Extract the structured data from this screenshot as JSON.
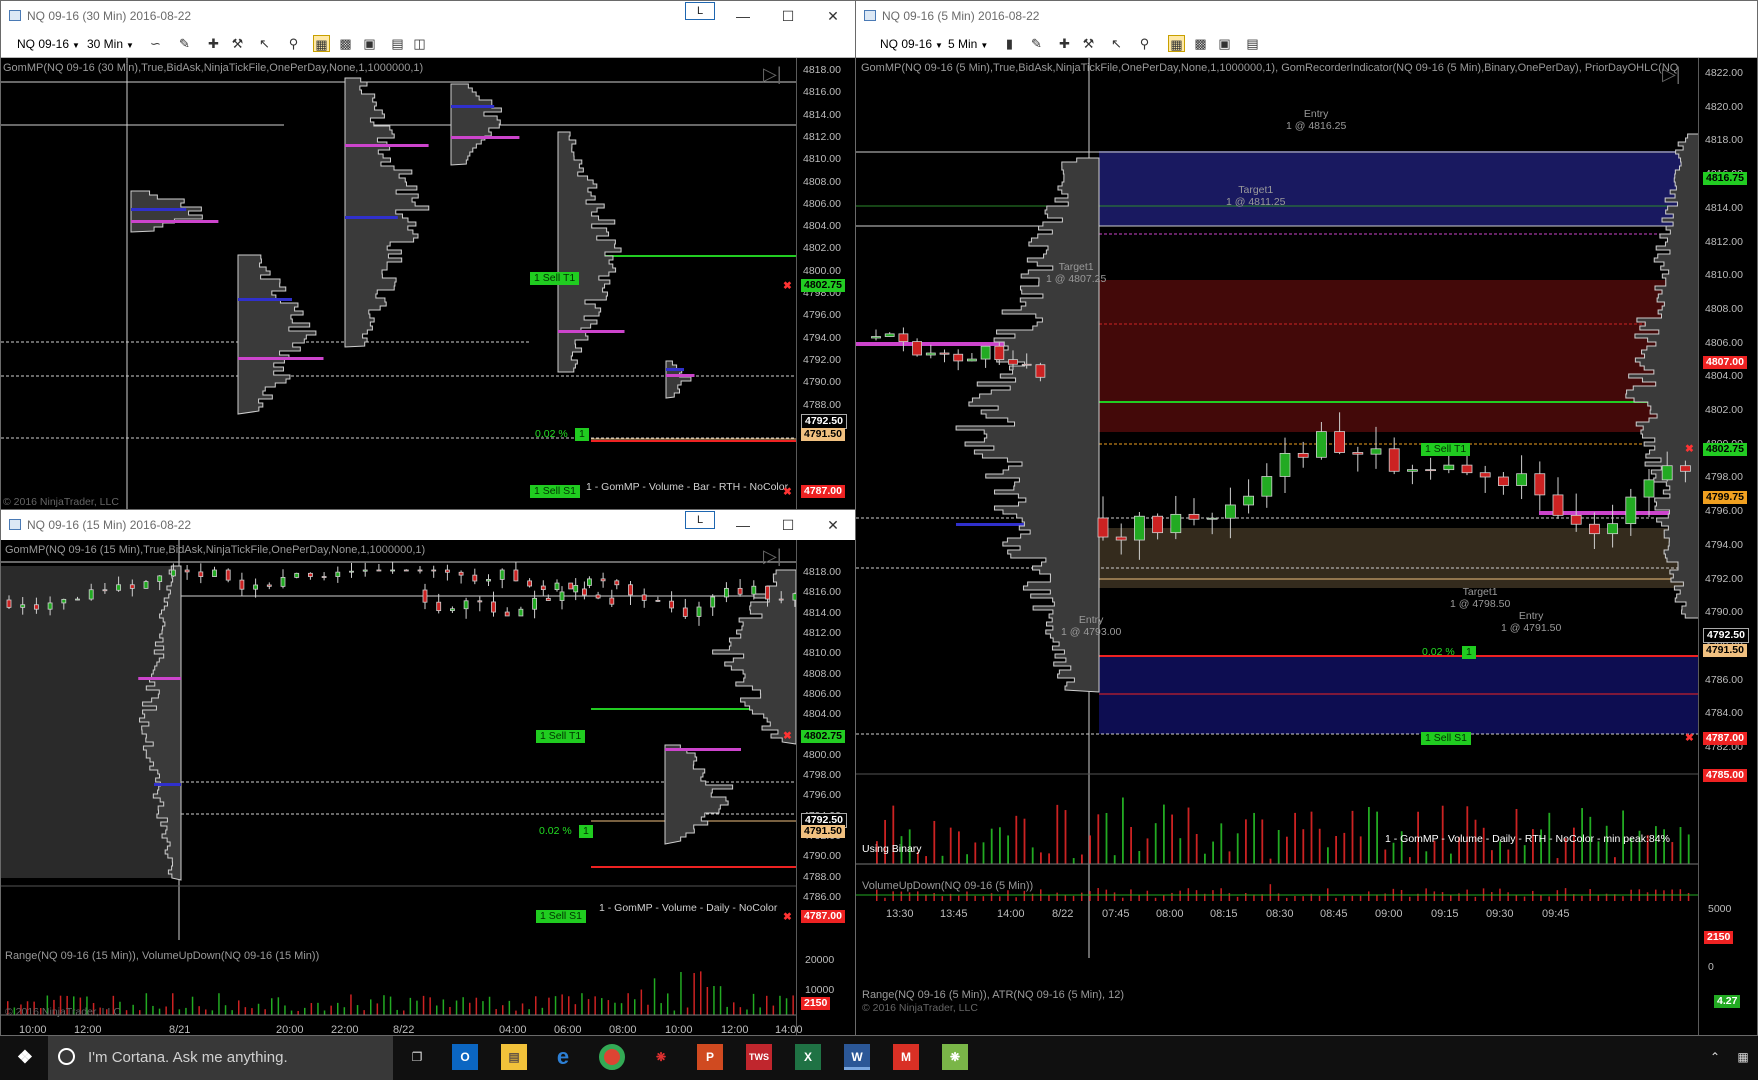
{
  "windows": [
    {
      "id": "w30",
      "title": "NQ 09-16 (30 Min)  2016-08-22",
      "instrument": "NQ 09-16",
      "interval": "30 Min",
      "link": "L",
      "indicator_label": "GomMP(NQ 09-16 (30 Min),True,BidAsk,NinjaTickFile,OnePerDay,None,1,1000000,1)",
      "ticks": [
        "4818.00",
        "4816.00",
        "4814.00",
        "4812.00",
        "4810.00",
        "4808.00",
        "4806.00",
        "4804.00",
        "4802.00",
        "4800.00",
        "4798.00",
        "4796.00",
        "4794.00",
        "4792.00",
        "4790.00",
        "4788.00"
      ],
      "price_tags": [
        {
          "text": "4802.75",
          "color": "#22cc22"
        },
        {
          "text": "4792.50",
          "color": "#ffffff"
        },
        {
          "text": "4791.50",
          "color": "#f0c080"
        },
        {
          "text": "4787.00",
          "color": "#ee2222"
        }
      ],
      "orders": [
        {
          "text": "1  Sell T1"
        },
        {
          "text": "1  Sell S1"
        }
      ],
      "pct": "0.02 %",
      "pct_qty": "1",
      "note": "1 - GomMP - Volume - Bar - RTH - NoColor",
      "copyright": "© 2016 NinjaTrader, LLC"
    },
    {
      "id": "w15",
      "title": "NQ 09-16 (15 Min)  2016-08-22",
      "instrument": "NQ 09-16",
      "interval": "15 Min",
      "link": "L",
      "indicator_label": "GomMP(NQ 09-16 (15 Min),True,BidAsk,NinjaTickFile,OnePerDay,None,1,1000000,1)",
      "ticks": [
        "4818.00",
        "4816.00",
        "4814.00",
        "4812.00",
        "4810.00",
        "4808.00",
        "4806.00",
        "4804.00",
        "4802.00",
        "4800.00",
        "4798.00",
        "4796.00",
        "4794.00",
        "4792.00",
        "4790.00",
        "4788.00",
        "4786.00"
      ],
      "price_tags": [
        {
          "text": "4802.75",
          "color": "#22cc22"
        },
        {
          "text": "4792.50",
          "color": "#ffffff"
        },
        {
          "text": "4791.50",
          "color": "#f0c080"
        },
        {
          "text": "4787.00",
          "color": "#ee2222"
        }
      ],
      "orders": [
        {
          "text": "1  Sell T1"
        },
        {
          "text": "1  Sell S1"
        }
      ],
      "pct": "0.02 %",
      "pct_qty": "1",
      "note": "1 - GomMP - Volume - Daily - NoColor",
      "sub_label": "Range(NQ 09-16 (15 Min)), VolumeUpDown(NQ 09-16 (15 Min))",
      "sub_ticks": [
        "20000",
        "10000"
      ],
      "sub_tag": "2150",
      "xticks": [
        "10:00",
        "12:00",
        "8/21",
        "20:00",
        "22:00",
        "8/22",
        "04:00",
        "06:00",
        "08:00",
        "10:00",
        "12:00",
        "14:00"
      ],
      "copyright": "© 2016 NinjaTrader, LLC"
    },
    {
      "id": "w5",
      "title": "NQ 09-16 (5 Min)  2016-08-22",
      "instrument": "NQ 09-16",
      "interval": "5 Min",
      "indicator_label": "GomMP(NQ 09-16 (5 Min),True,BidAsk,NinjaTickFile,OnePerDay,None,1,1000000,1), GomRecorderIndicator(NQ 09-16 (5 Min),Binary,OnePerDay), PriorDayOHLC(NQ",
      "ticks": [
        "4822.00",
        "4820.00",
        "4818.00",
        "4816.00",
        "4814.00",
        "4812.00",
        "4810.00",
        "4808.00",
        "4806.00",
        "4804.00",
        "4802.00",
        "4800.00",
        "4798.00",
        "4796.00",
        "4794.00",
        "4792.00",
        "4790.00",
        "4788.00",
        "4786.00",
        "4784.00",
        "4782.00"
      ],
      "price_tags": [
        {
          "text": "4816.75",
          "color": "#22cc22"
        },
        {
          "text": "4807.00",
          "color": "#ee2222"
        },
        {
          "text": "4802.75",
          "color": "#22cc22"
        },
        {
          "text": "4799.75",
          "color": "#f0a020"
        },
        {
          "text": "4792.50",
          "color": "#ffffff"
        },
        {
          "text": "4791.50",
          "color": "#f0c080"
        },
        {
          "text": "4787.00",
          "color": "#ee2222"
        },
        {
          "text": "4785.00",
          "color": "#ee2222"
        }
      ],
      "orders": [
        {
          "text": "1  Sell T1"
        },
        {
          "text": "1  Sell S1"
        }
      ],
      "pct": "0.02 %",
      "pct_qty": "1",
      "annotations": [
        {
          "text": "Entry",
          "sub": "1 @ 4816.25"
        },
        {
          "text": "Target1",
          "sub": "1 @ 4811.25"
        },
        {
          "text": "Target1",
          "sub": "1 @ 4807.25"
        },
        {
          "text": "Entry",
          "sub": "1 @ 4793.00"
        },
        {
          "text": "Target1",
          "sub": "1 @ 4798.50"
        },
        {
          "text": "Entry",
          "sub": "1 @ 4791.50"
        }
      ],
      "using": "Using Binary",
      "note": "1 - GomMP - Volume - Daily - RTH - NoColor - min peak:84%",
      "vol_label": "VolumeUpDown(NQ 09-16 (5 Min))",
      "vol_ticks": [
        "5000",
        "0"
      ],
      "vol_tag": "2150",
      "range_label": "Range(NQ 09-16 (5 Min)), ATR(NQ 09-16 (5 Min), 12)",
      "range_tag": "4.27",
      "xticks": [
        "13:30",
        "13:45",
        "14:00",
        "8/22",
        "07:45",
        "08:00",
        "08:15",
        "08:30",
        "08:45",
        "09:00",
        "09:15",
        "09:30",
        "09:45"
      ],
      "copyright": "© 2016 NinjaTrader, LLC"
    }
  ],
  "taskbar": {
    "search_placeholder": "I'm Cortana. Ask me anything.",
    "apps": [
      "Outlook",
      "File Explorer",
      "Edge",
      "Chrome",
      "Acrobat",
      "PowerPoint",
      "TWS",
      "Excel",
      "Word",
      "Gmail",
      "NinjaTrader"
    ]
  },
  "colors": {
    "bull": "#22aa22",
    "bear": "#cc2222",
    "poc": "#cc44cc",
    "va": "#3030cc"
  }
}
